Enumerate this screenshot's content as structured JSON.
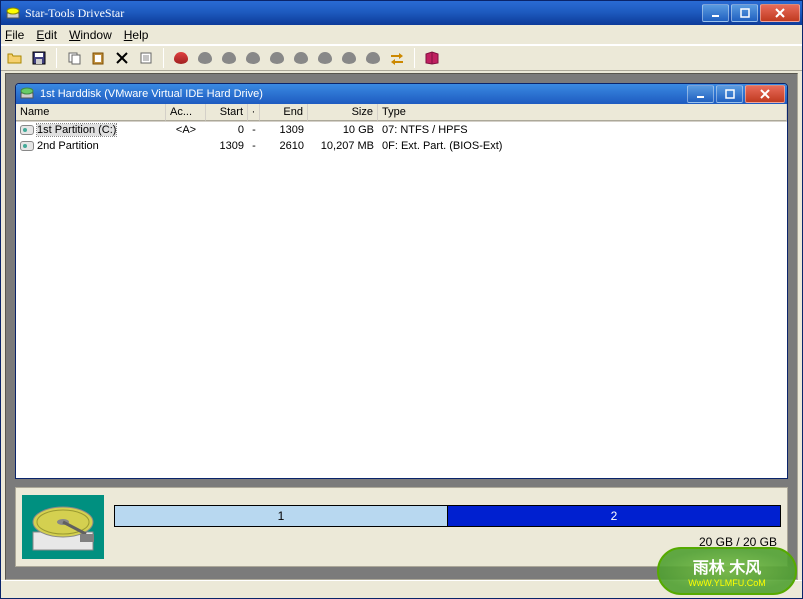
{
  "window": {
    "title": "Star-Tools DriveStar"
  },
  "menu": {
    "file": "File",
    "edit": "Edit",
    "window": "Window",
    "help": "Help"
  },
  "child": {
    "title": "1st Harddisk (VMware Virtual IDE Hard Drive)"
  },
  "columns": {
    "name": "Name",
    "ac": "Ac...",
    "start": "Start",
    "dash": "·",
    "end": "End",
    "size": "Size",
    "type": "Type"
  },
  "partitions": [
    {
      "name": "1st Partition (C:)",
      "ac": "<A>",
      "start": "0",
      "dash": "-",
      "end": "1309",
      "size": "10 GB",
      "type": "07: NTFS / HPFS"
    },
    {
      "name": "2nd Partition",
      "ac": "",
      "start": "1309",
      "dash": "-",
      "end": "2610",
      "size": "10,207 MB",
      "type": "0F: Ext. Part. (BIOS-Ext)"
    }
  ],
  "bars": {
    "p1": "1",
    "p2": "2"
  },
  "capacity": "20 GB / 20 GB",
  "watermark": {
    "big": "雨林 木风",
    "small": "WwW.YLMFU.CoM"
  }
}
